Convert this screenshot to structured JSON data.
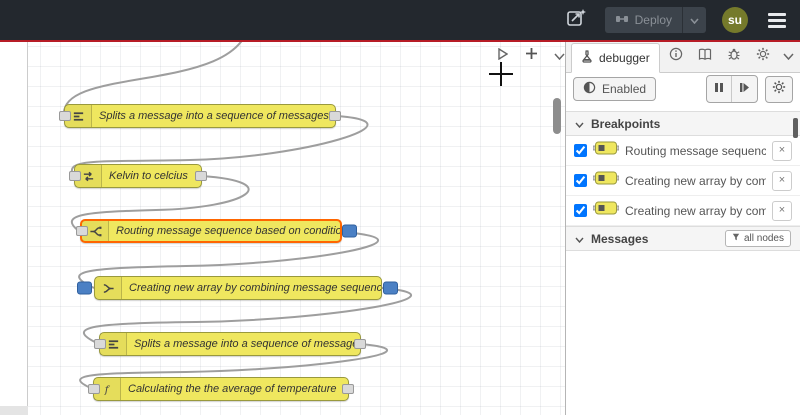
{
  "header": {
    "deploy": {
      "label": "Deploy"
    },
    "avatar": {
      "initials": "su"
    }
  },
  "canvas": {
    "nodes": [
      {
        "label": "Splits a message into a sequence of messages.",
        "icon": "split-icon"
      },
      {
        "label": "Kelvin to celcius",
        "icon": "change-icon"
      },
      {
        "label": "Routing message sequence based on condition",
        "icon": "switch-icon",
        "state": "breakpoint-selected"
      },
      {
        "label": "Creating new array by combining message sequence",
        "icon": "join-icon",
        "state": "breakpoint-both-ports"
      },
      {
        "label": "Splits a message into a sequence of messages.",
        "icon": "split-icon"
      },
      {
        "label": "Calculating the the average of temperature",
        "icon": "function-icon"
      }
    ]
  },
  "sidebar": {
    "tab_label": "debugger",
    "enabled_label": "Enabled",
    "breakpoints_title": "Breakpoints",
    "messages_title": "Messages",
    "filter_label": "all nodes",
    "close_glyph": "×",
    "breakpoints": [
      {
        "checked": true,
        "label": "Routing message sequence ba"
      },
      {
        "checked": true,
        "label": "Creating new array by combini"
      },
      {
        "checked": true,
        "label": "Creating new array by combini"
      }
    ]
  },
  "icons": {
    "export-icon": "framed-arrow-with-sparkle",
    "deploy-icon": "linked-nodes",
    "chevron-down-icon": "▾",
    "menu-icon": "☰",
    "play-icon": "▶",
    "add-icon": "+",
    "flask-icon": "debugger-flask",
    "info-icon": "i",
    "book-icon": "book",
    "bug-icon": "bug",
    "gear-icon": "⚙",
    "toggle-icon": "◐",
    "pause-icon": "❙❙",
    "step-icon": "❙▶",
    "funnel-icon": "filter-funnel",
    "crosshair-cursor": "+"
  },
  "colors": {
    "header_bg": "#23282e",
    "accent_red": "#b71c26",
    "node_fill": "#efe75f",
    "node_border": "#99993d",
    "node_selected_border": "#ff6600",
    "breakpoint_blue": "#4b80c4",
    "wire": "#9e9e9e",
    "avatar_bg": "#757a2b"
  }
}
